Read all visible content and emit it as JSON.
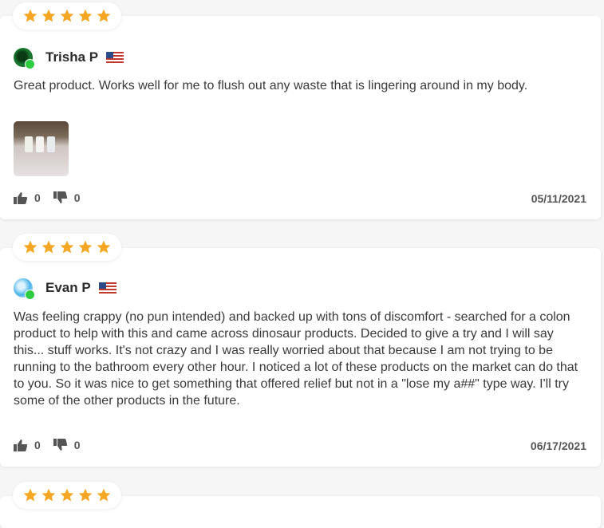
{
  "colors": {
    "star": "#f5a623",
    "verified": "#2ecc40",
    "card_bg": "#ffffff",
    "page_bg": "#f6f6f6"
  },
  "reviews": [
    {
      "rating": 5,
      "author": "Trisha P",
      "flag": "us-flag-icon",
      "text": "Great product. Works well for me to flush out any waste that is lingering around in my body.",
      "has_photo": true,
      "likes": "0",
      "dislikes": "0",
      "date": "05/11/2021"
    },
    {
      "rating": 5,
      "author": "Evan P",
      "flag": "us-flag-icon",
      "text": "Was feeling crappy (no pun intended) and backed up with tons of discomfort - searched for a colon product to help with this and came across dinosaur products. Decided to give a try and I will say this... stuff works. It's not crazy and I was really worried about that because I am not trying to be running to the bathroom every other hour. I noticed a lot of these products on the market can do that to you. So it was nice to get something that offered relief but not in a \"lose my a##\" type way. I'll try some of the other products in the future.",
      "has_photo": false,
      "likes": "0",
      "dislikes": "0",
      "date": "06/17/2021"
    },
    {
      "rating": 5
    }
  ]
}
